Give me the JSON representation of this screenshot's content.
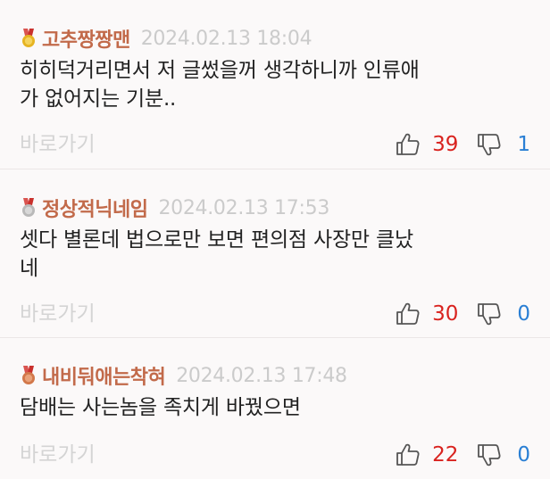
{
  "comments": [
    {
      "medal": "gold-medal-icon",
      "nickname": "고추짱짱맨",
      "timestamp": "2024.02.13 18:04",
      "text_lines": [
        "히히덕거리면서 저 글썼을꺼 생각하니까 인류애",
        "가 없어지는 기분.."
      ],
      "goto_label": "바로가기",
      "upvotes": "39",
      "downvotes": "1"
    },
    {
      "medal": "silver-medal-icon",
      "nickname": "정상적닉네임",
      "timestamp": "2024.02.13 17:53",
      "text_lines": [
        "셋다 별론데 법으로만 보면 편의점 사장만 클났",
        "네"
      ],
      "goto_label": "바로가기",
      "upvotes": "30",
      "downvotes": "0"
    },
    {
      "medal": "bronze-medal-icon",
      "nickname": "내비둬애는착혀",
      "timestamp": "2024.02.13 17:48",
      "text_lines": [
        "담배는 사는놈을 족치게 바꿨으면"
      ],
      "goto_label": "바로가기",
      "upvotes": "22",
      "downvotes": "0"
    }
  ],
  "colors": {
    "nickname": "#c26a4a",
    "timestamp": "#cbcbcb",
    "upvote": "#d9231f",
    "downvote": "#2a7fd4",
    "gold": "#e6b422",
    "silver": "#b9b9b9",
    "bronze": "#d2784a"
  },
  "icons": {
    "upvote": "thumbs-up-icon",
    "downvote": "thumbs-down-icon"
  }
}
